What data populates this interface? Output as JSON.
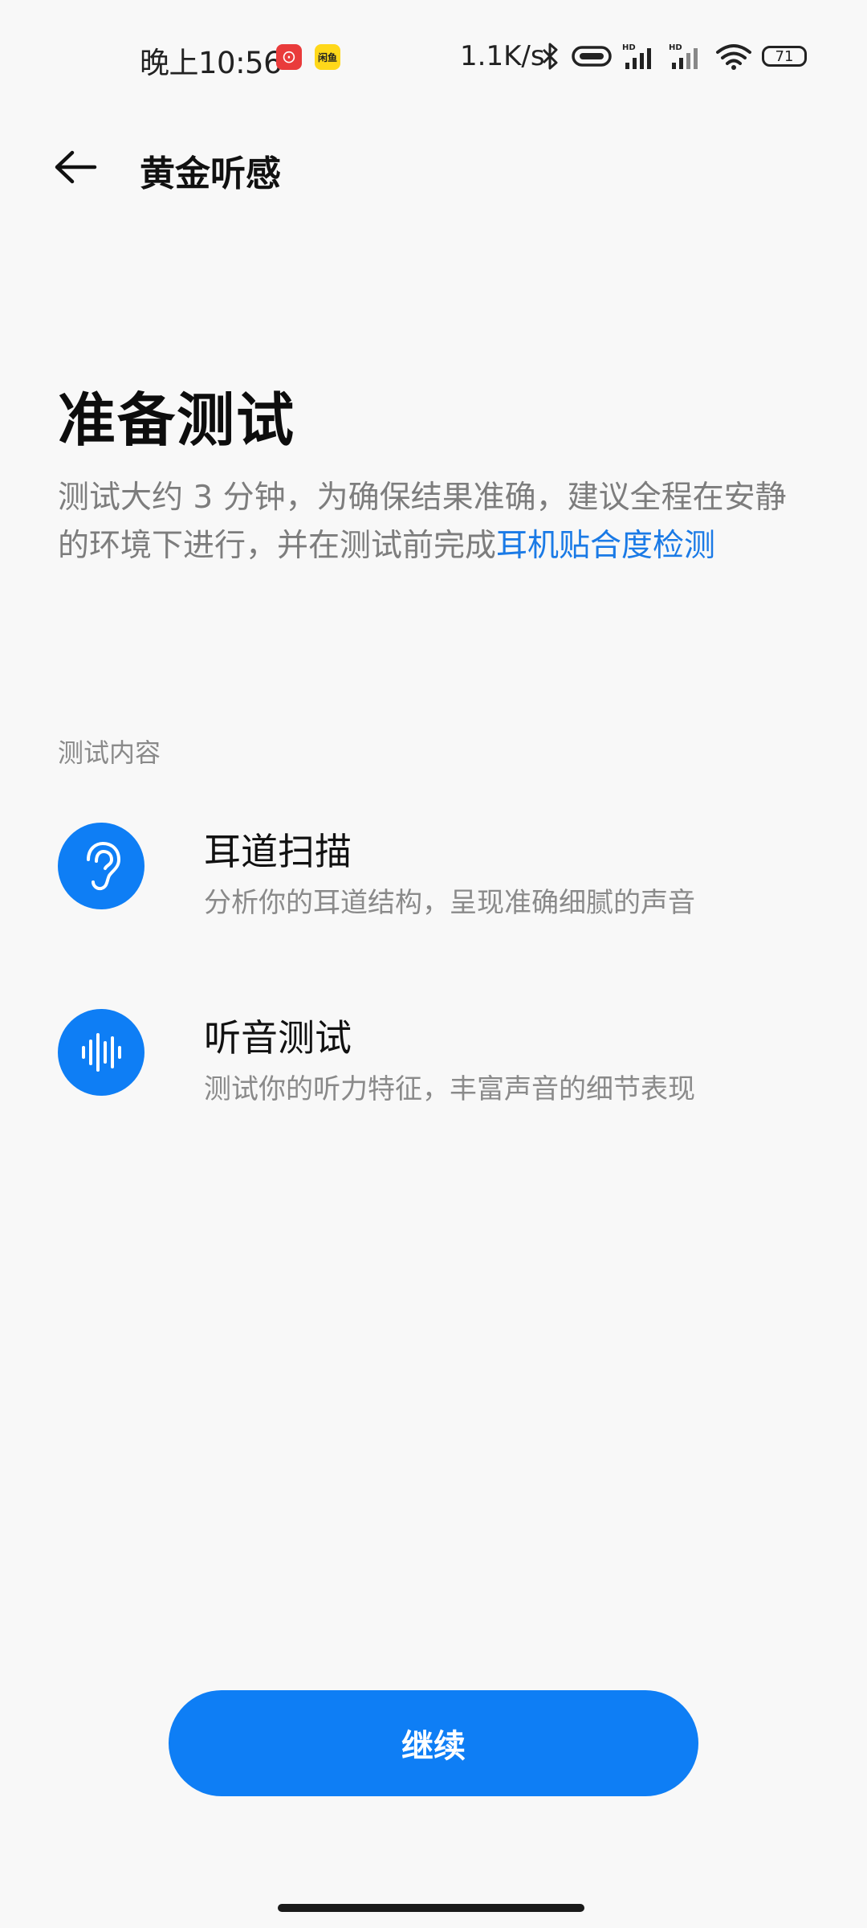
{
  "status_bar": {
    "time": "晚上10:56",
    "app_icon_1_glyph": "⊙",
    "app_icon_2_text": "闲鱼",
    "net_speed": "1.1K/s",
    "battery": "71"
  },
  "app_bar": {
    "title": "黄金听感"
  },
  "main": {
    "heading": "准备测试",
    "description_text": "测试大约 3 分钟，为确保结果准确，建议全程在安静的环境下进行，并在测试前完成",
    "description_link": "耳机贴合度检测",
    "section_label": "测试内容",
    "items": [
      {
        "icon": "ear-icon",
        "title": "耳道扫描",
        "desc": "分析你的耳道结构，呈现准确细腻的声音"
      },
      {
        "icon": "waveform-icon",
        "title": "听音测试",
        "desc": "测试你的听力特征，丰富声音的细节表现"
      }
    ],
    "continue_label": "继续"
  },
  "colors": {
    "accent": "#0e7ef5",
    "link": "#1a7ae6",
    "background": "#f8f8f8"
  }
}
